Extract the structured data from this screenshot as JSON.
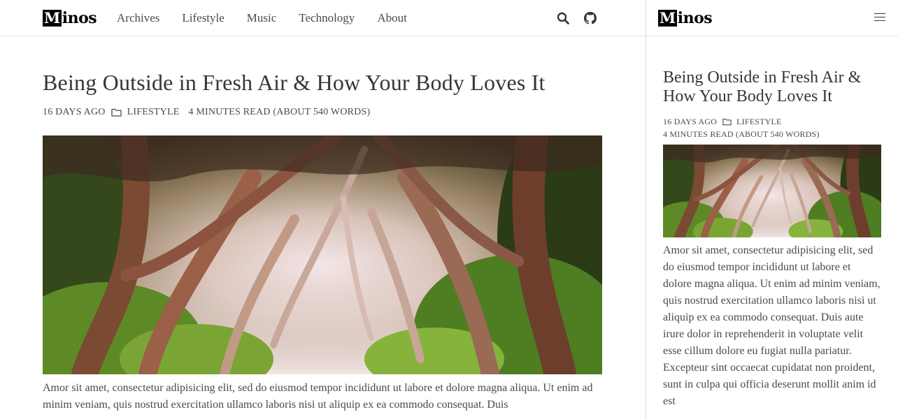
{
  "site": {
    "logo_initial": "M",
    "logo_rest": "inos"
  },
  "nav": {
    "links": [
      "Archives",
      "Lifestyle",
      "Music",
      "Technology",
      "About"
    ],
    "icons": [
      "search-icon",
      "github-icon"
    ]
  },
  "post": {
    "title": "Being Outside in Fresh Air & How Your Body Loves It",
    "date": "16 days ago",
    "category": "Lifestyle",
    "read_time": "4 minutes read (About 540 words)",
    "body_desktop": "Amor sit amet, consectetur adipisicing elit, sed do eiusmod tempor incididunt ut labore et dolore magna aliqua. Ut enim ad minim veniam, quis nostrud exercitation ullamco laboris nisi ut aliquip ex ea commodo consequat. Duis",
    "body_mobile": "Amor sit amet, consectetur adipisicing elit, sed do eiusmod tempor incididunt ut labore et dolore magna aliqua. Ut enim ad minim veniam, quis nostrud exercitation ullamco laboris nisi ut aliquip ex ea commodo consequat. Duis aute irure dolor in reprehenderit in voluptate velit esse cillum dolore eu fugiat nulla pariatur. Excepteur sint occaecat cupidatat non proident, sunt in culpa qui officia deserunt mollit anim id est"
  },
  "colors": {
    "text": "#363636",
    "muted": "#4a4a4a",
    "border": "#e5e5e5",
    "logo_bg": "#000000"
  }
}
